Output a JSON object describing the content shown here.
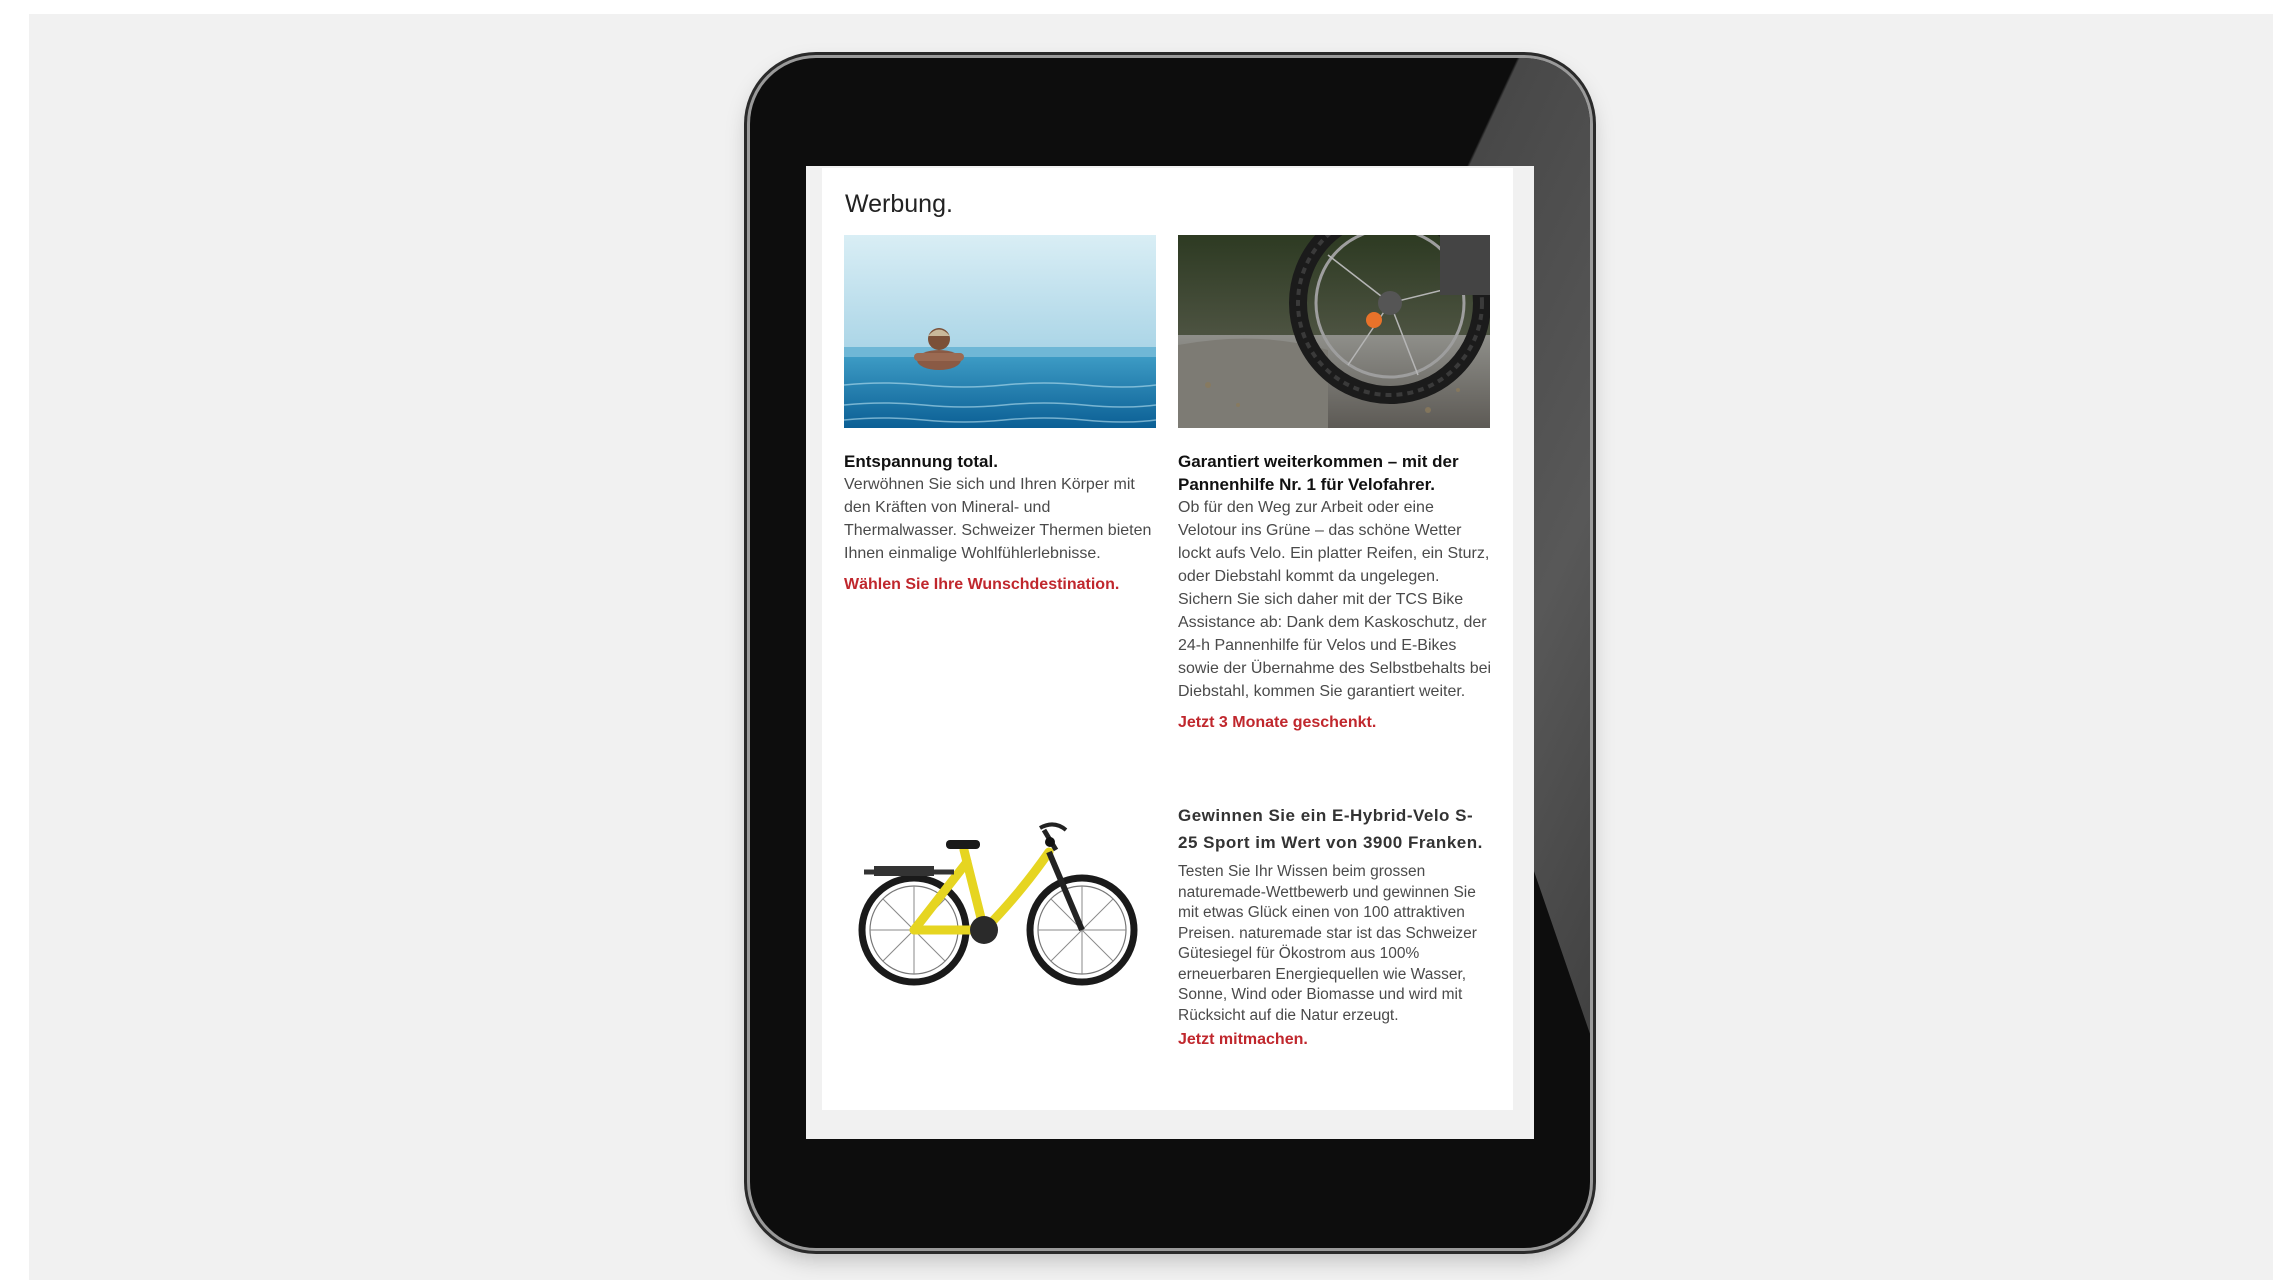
{
  "ad_page": {
    "title": "Werbung.",
    "items": [
      {
        "heading": "Entspannung total.",
        "body": "Verwöhnen Sie sich und Ihren Körper mit den Kräften von Mineral- und Thermalwasser. Schweizer Thermen bieten Ihnen einmalige Wohlfühlerlebnisse.",
        "link": "Wählen Sie Ihre Wunschdestination."
      },
      {
        "heading": "Garantiert weiterkommen – mit der Pannenhilfe Nr. 1 für Velofahrer.",
        "body": "Ob für den Weg zur Arbeit oder eine Velotour ins Grüne – das schöne Wetter lockt aufs Velo. Ein platter Reifen, ein Sturz, oder Diebstahl kommt da ungelegen. Sichern Sie sich daher mit der TCS Bike Assistance ab: Dank dem Kaskoschutz, der 24-h Pannenhilfe für Velos und E-Bikes sowie der Übernahme des Selbstbehalts bei Diebstahl, kommen Sie garantiert weiter.",
        "link": "Jetzt 3 Monate geschenkt."
      },
      {
        "heading": "Gewinnen Sie ein E-Hybrid-Velo S-25 Sport im Wert von 3900 Franken.",
        "body": "Testen Sie Ihr Wissen beim grossen naturemade-Wettbewerb und gewinnen Sie mit etwas Glück einen von 100 attraktiven Preisen. naturemade star ist das Schweizer Gütesiegel für Ökostrom aus 100% erneuerbaren Energiequellen wie Wasser, Sonne, Wind oder Biomasse und wird mit Rücksicht auf die Natur erzeugt.",
        "link": "Jetzt mitmachen."
      }
    ]
  },
  "colors": {
    "link": "#c0272d",
    "device": "#0d0d0d",
    "background": "#f1f1f1"
  }
}
